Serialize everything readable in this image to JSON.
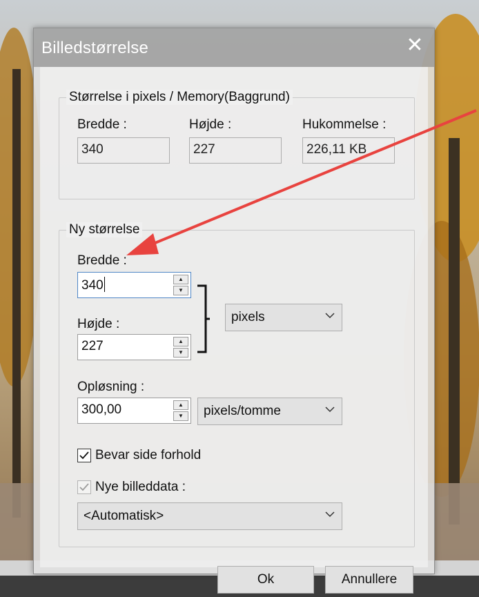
{
  "dialog": {
    "title": "Billedstørrelse",
    "close_icon": "close-icon"
  },
  "current_size": {
    "legend": "Størrelse i pixels / Memory(Baggrund)",
    "width_label": "Bredde :",
    "width_value": "340",
    "height_label": "Højde :",
    "height_value": "227",
    "memory_label": "Hukommelse :",
    "memory_value": "226,11 KB"
  },
  "new_size": {
    "legend": "Ny størrelse",
    "width_label": "Bredde :",
    "width_value": "340",
    "height_label": "Højde :",
    "height_value": "227",
    "unit_selected": "pixels",
    "resolution_label": "Opløsning :",
    "resolution_value": "300,00",
    "resolution_unit_selected": "pixels/tomme",
    "keep_ratio_label": "Bevar side forhold",
    "keep_ratio_checked": true,
    "resample_label": "Nye billeddata :",
    "resample_checked": true,
    "resample_method": "<Automatisk>"
  },
  "buttons": {
    "ok": "Ok",
    "cancel": "Annullere"
  },
  "annotation": {
    "arrow_color": "#e8433f"
  },
  "icons": {
    "spinner_up": "spin-up-icon",
    "spinner_down": "spin-down-icon",
    "dropdown": "chevron-down-icon",
    "link_bracket": "link-bracket-icon",
    "checkmark": "checkmark-icon"
  }
}
